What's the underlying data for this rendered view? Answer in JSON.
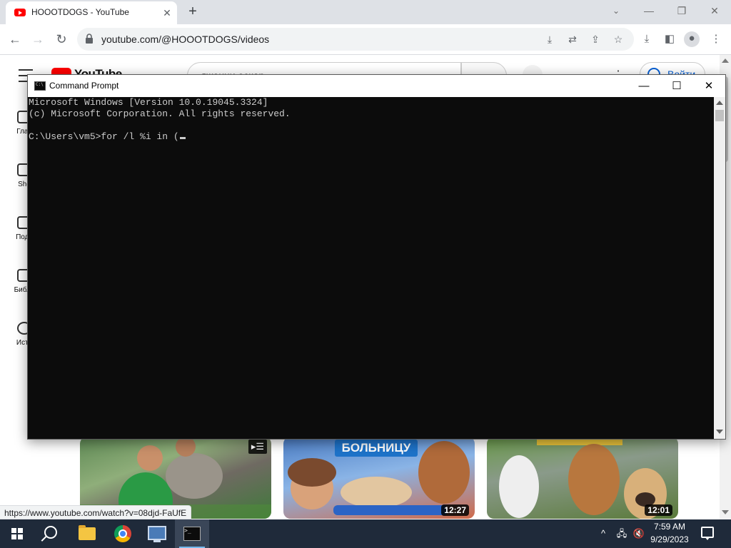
{
  "browser": {
    "tab_title": "HOOOTDOGS - YouTube",
    "tab_close": "✕",
    "new_tab": "+",
    "window_controls": {
      "minimize": "—",
      "restore": "❐",
      "close": "✕"
    },
    "url": "youtube.com/@HOOOTDOGS/videos",
    "status_url": "https://www.youtube.com/watch?v=08djd-FaUfE"
  },
  "youtube": {
    "logo_text": "YouTube",
    "search_value": "джонни оскар",
    "signin_label": "Войти",
    "guide": [
      {
        "label": "Глав"
      },
      {
        "label": "Sho"
      },
      {
        "label": "Подп"
      },
      {
        "label": "Библи"
      },
      {
        "label": "Исто"
      }
    ],
    "videos": [
      {
        "duration": ""
      },
      {
        "duration": "12:27",
        "overlay_text": "БОЛЬНИЦУ"
      },
      {
        "duration": "12:01"
      }
    ],
    "brand_color": "#ff0000"
  },
  "cmd": {
    "title": "Command Prompt",
    "controls": {
      "minimize": "—",
      "maximize": "☐",
      "close": "✕"
    },
    "lines": [
      "Microsoft Windows [Version 10.0.19045.3324]",
      "(c) Microsoft Corporation. All rights reserved.",
      "",
      "C:\\Users\\vm5>for /l %i in ("
    ]
  },
  "taskbar": {
    "tray": {
      "chevron": "^",
      "network": "🖧",
      "volume": "🔇"
    },
    "time": "7:59 AM",
    "date": "9/29/2023",
    "items": [
      "start-icon",
      "search-icon",
      "file-explorer-icon",
      "chrome-icon",
      "network-config-icon",
      "command-prompt-icon"
    ]
  }
}
